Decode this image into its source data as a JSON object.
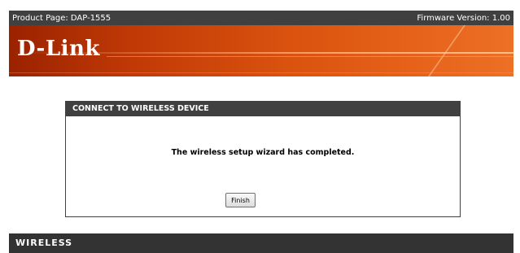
{
  "header": {
    "product_page": "Product Page: DAP-1555",
    "firmware_version": "Firmware Version: 1.00"
  },
  "brand": {
    "logo_text": "D-Link",
    "colors": {
      "banner_dark": "#9a2200",
      "banner_light": "#ec7026",
      "bar": "#404040"
    }
  },
  "panel": {
    "title": "CONNECT TO WIRELESS DEVICE",
    "message": "The wireless setup wizard has completed.",
    "finish_label": "Finish"
  },
  "footer": {
    "label": "WIRELESS"
  }
}
